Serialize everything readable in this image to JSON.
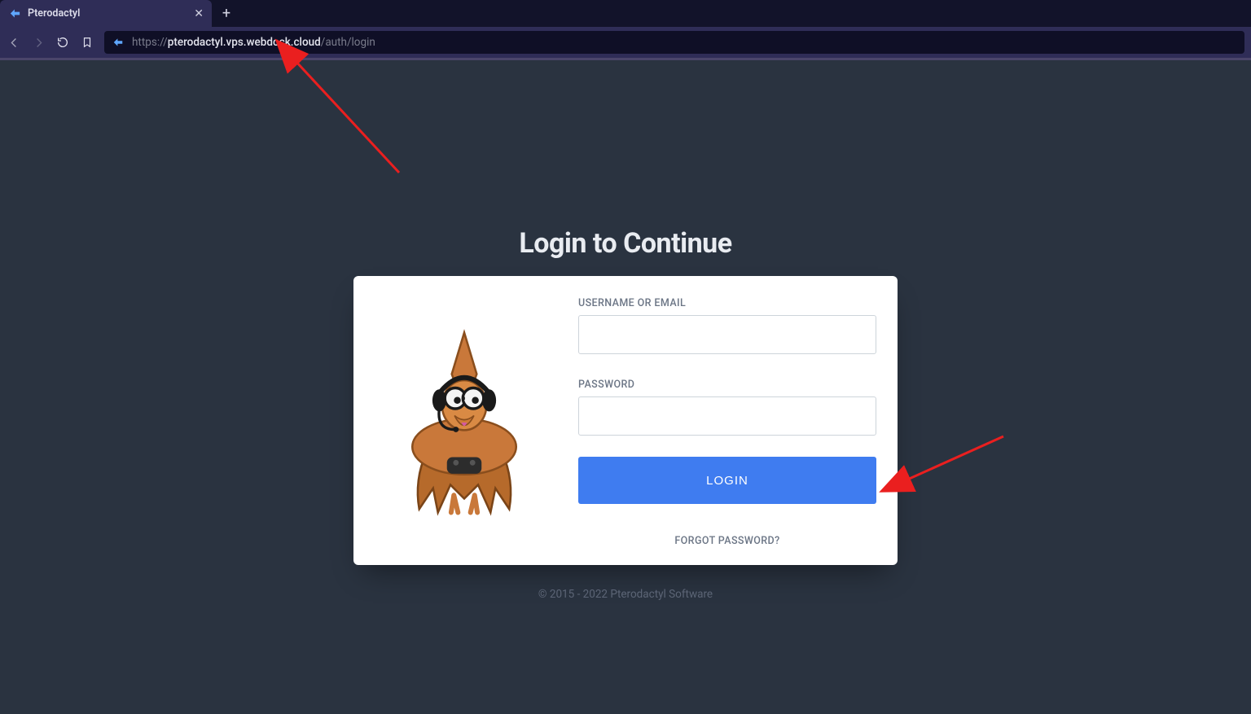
{
  "browser": {
    "tab_title": "Pterodactyl",
    "url_scheme": "https://",
    "url_host": "pterodactyl.vps.webdock.cloud",
    "url_path": "/auth/login"
  },
  "page": {
    "heading": "Login to Continue",
    "form": {
      "username_label": "USERNAME OR EMAIL",
      "username_value": "",
      "password_label": "PASSWORD",
      "password_value": "",
      "login_button": "LOGIN",
      "forgot_link": "FORGOT PASSWORD?"
    },
    "footer": "© 2015 - 2022 Pterodactyl Software"
  },
  "colors": {
    "accent_button": "#3f7cf0",
    "annotation_arrow": "#ea1f1f"
  }
}
